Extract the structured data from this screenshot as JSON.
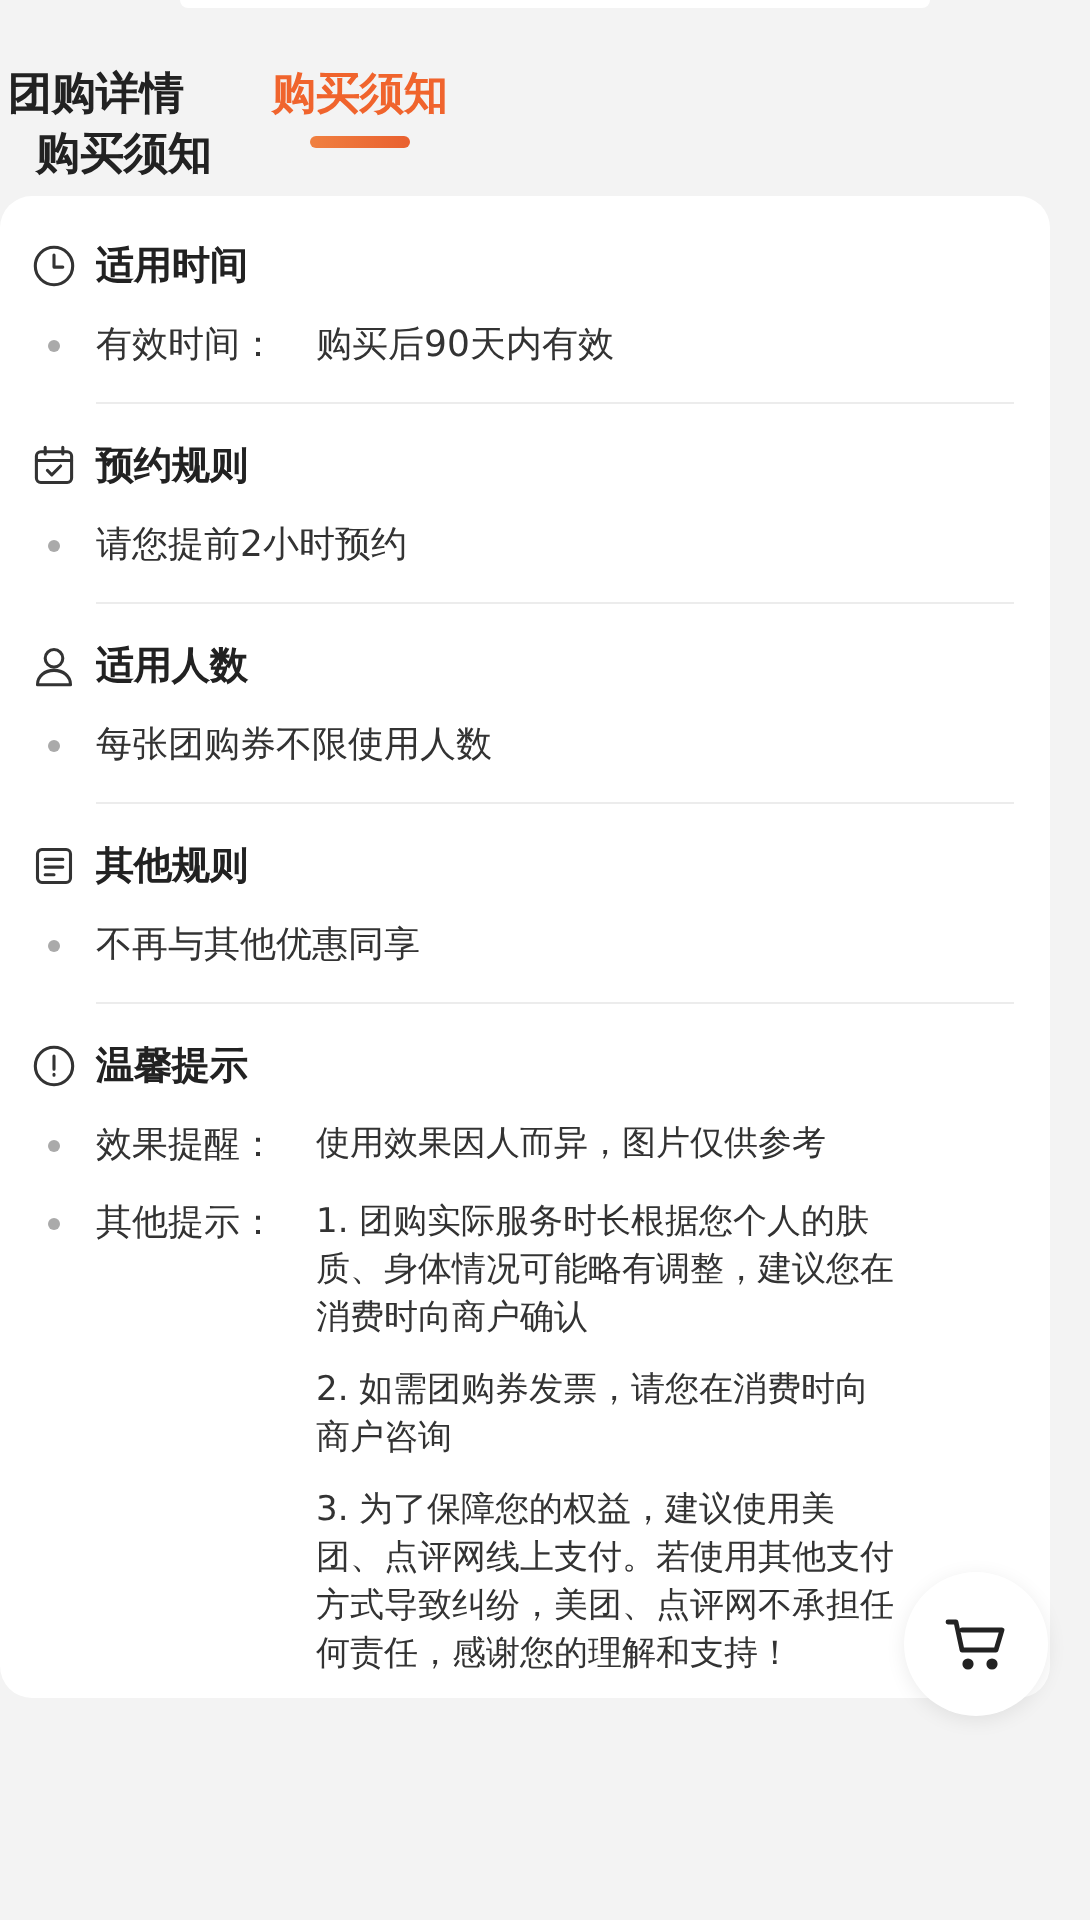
{
  "tabs": [
    {
      "label": "团购详情",
      "selected": false
    },
    {
      "label": "购买须知",
      "selected": true
    }
  ],
  "heading": "购买须知",
  "sections": [
    {
      "title": "适用时间",
      "items": [
        {
          "label": "有效时间：",
          "values": [
            "购买后90天内有效"
          ]
        }
      ]
    },
    {
      "title": "预约规则",
      "items": [
        {
          "values": [
            "请您提前2小时预约"
          ]
        }
      ]
    },
    {
      "title": "适用人数",
      "items": [
        {
          "values": [
            "每张团购券不限使用人数"
          ]
        }
      ]
    },
    {
      "title": "其他规则",
      "items": [
        {
          "values": [
            "不再与其他优惠同享"
          ]
        }
      ]
    },
    {
      "title": "温馨提示",
      "items": [
        {
          "label": "效果提醒：",
          "values": [
            "使用效果因人而异，图片仅供参考"
          ]
        },
        {
          "label": "其他提示：",
          "values": [
            "1. 团购实际服务时长根据您个人的肤质、身体情况可能略有调整，建议您在消费时向商户确认",
            "2. 如需团购券发票，请您在消费时向商户咨询",
            "3. 为了保障您的权益，建议使用美团、点评网线上支付。若使用其他支付方式导致纠纷，美团、点评网不承担任何责任，感谢您的理解和支持！"
          ]
        }
      ]
    }
  ]
}
